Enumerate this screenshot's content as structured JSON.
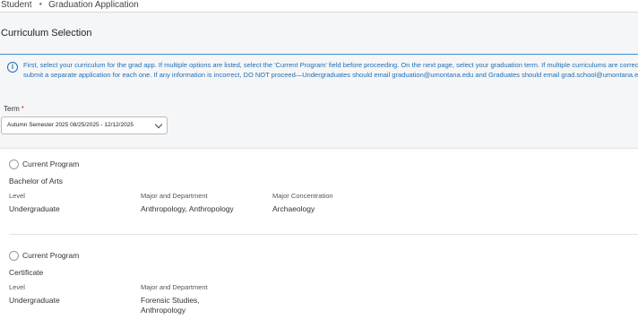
{
  "breadcrumb": {
    "items": [
      "Student",
      "Graduation Application"
    ]
  },
  "page_title": "Curriculum Selection",
  "info": {
    "line1": "First, select your curriculum for the grad app. If multiple options are listed, select the 'Current Program' field before proceeding. On the next page, select your graduation term. If multiple curriculums are correct,",
    "line2": "submit a separate application for each one. If any information is incorrect, DO NOT proceed—Undergraduates should email graduation@umontana.edu and Graduates should email grad.school@umontana.edu."
  },
  "term": {
    "label": "Term",
    "required_mark": "*",
    "selected": "Autumn Semester 2025 08/25/2025 - 12/12/2025"
  },
  "programs": [
    {
      "radio_label": "Current Program",
      "degree": "Bachelor of Arts",
      "level_label": "Level",
      "level": "Undergraduate",
      "major_label": "Major and Department",
      "major": "Anthropology, Anthropology",
      "concentration_label": "Major Concentration",
      "concentration": "Archaeology"
    },
    {
      "radio_label": "Current Program",
      "degree": "Certificate",
      "level_label": "Level",
      "level": "Undergraduate",
      "major_label": "Major and Department",
      "major_line1": "Forensic Studies,",
      "major_line2": "Anthropology"
    }
  ]
}
